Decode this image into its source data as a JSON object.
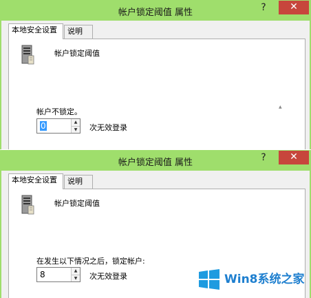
{
  "windows": [
    {
      "title": "帐户锁定阈值 属性",
      "help": "?",
      "close": "✕",
      "tabs": [
        {
          "label": "本地安全设置"
        },
        {
          "label": "说明"
        }
      ],
      "policy_name": "帐户锁定阈值",
      "description": "帐户不锁定。",
      "spinner_value": "0",
      "unit": "次无效登录"
    },
    {
      "title": "帐户锁定阈值 属性",
      "help": "?",
      "close": "✕",
      "tabs": [
        {
          "label": "本地安全设置"
        },
        {
          "label": "说明"
        }
      ],
      "policy_name": "帐户锁定阈值",
      "description": "在发生以下情况之后，锁定帐户:",
      "spinner_value": "8",
      "unit": "次无效登录"
    }
  ],
  "watermark": {
    "text": "Win8系统之家",
    "color": "#1e7fcf"
  },
  "colors": {
    "titlebar": "#9fde6c",
    "close": "#c7463c",
    "selection": "#3399ff"
  }
}
